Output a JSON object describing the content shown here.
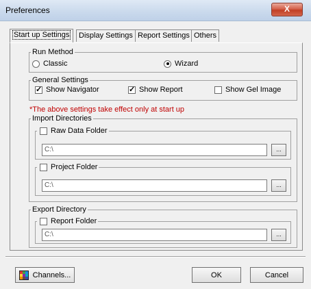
{
  "window": {
    "title": "Preferences",
    "close_glyph": "X"
  },
  "tabs": [
    {
      "label": "Start up Settings",
      "active": true
    },
    {
      "label": "Display Settings",
      "active": false
    },
    {
      "label": "Report Settings",
      "active": false
    },
    {
      "label": "Others",
      "active": false
    }
  ],
  "run_method": {
    "legend": "Run Method",
    "options": [
      {
        "label": "Classic",
        "selected": false
      },
      {
        "label": "Wizard",
        "selected": true
      }
    ]
  },
  "general_settings": {
    "legend": "General Settings",
    "show_navigator": {
      "label": "Show Navigator",
      "checked": true
    },
    "show_report": {
      "label": "Show Report",
      "checked": true
    },
    "show_gel_image": {
      "label": "Show Gel Image",
      "checked": false
    }
  },
  "startup_note": "*The above settings take effect only at start up",
  "import_directories": {
    "legend": "Import Directories",
    "raw_data_folder": {
      "label": "Raw Data Folder",
      "checked": false,
      "path": "C:\\",
      "browse_label": "..."
    },
    "project_folder": {
      "label": "Project Folder",
      "checked": false,
      "path": "C:\\",
      "browse_label": "..."
    }
  },
  "export_directory": {
    "legend": "Export Directory",
    "report_folder": {
      "label": "Report Folder",
      "checked": false,
      "path": "C:\\",
      "browse_label": "..."
    }
  },
  "footer": {
    "channels_label": "Channels...",
    "ok_label": "OK",
    "cancel_label": "Cancel"
  },
  "colors": {
    "note_red": "#c00000",
    "close_button": "#c13f24",
    "channels_icon": [
      "#e53935",
      "#43a047",
      "#1e88e5",
      "#fdd835",
      "#8e24aa",
      "#00acc1",
      "#fb8c00",
      "#6d4c41",
      "#3949ab"
    ]
  }
}
